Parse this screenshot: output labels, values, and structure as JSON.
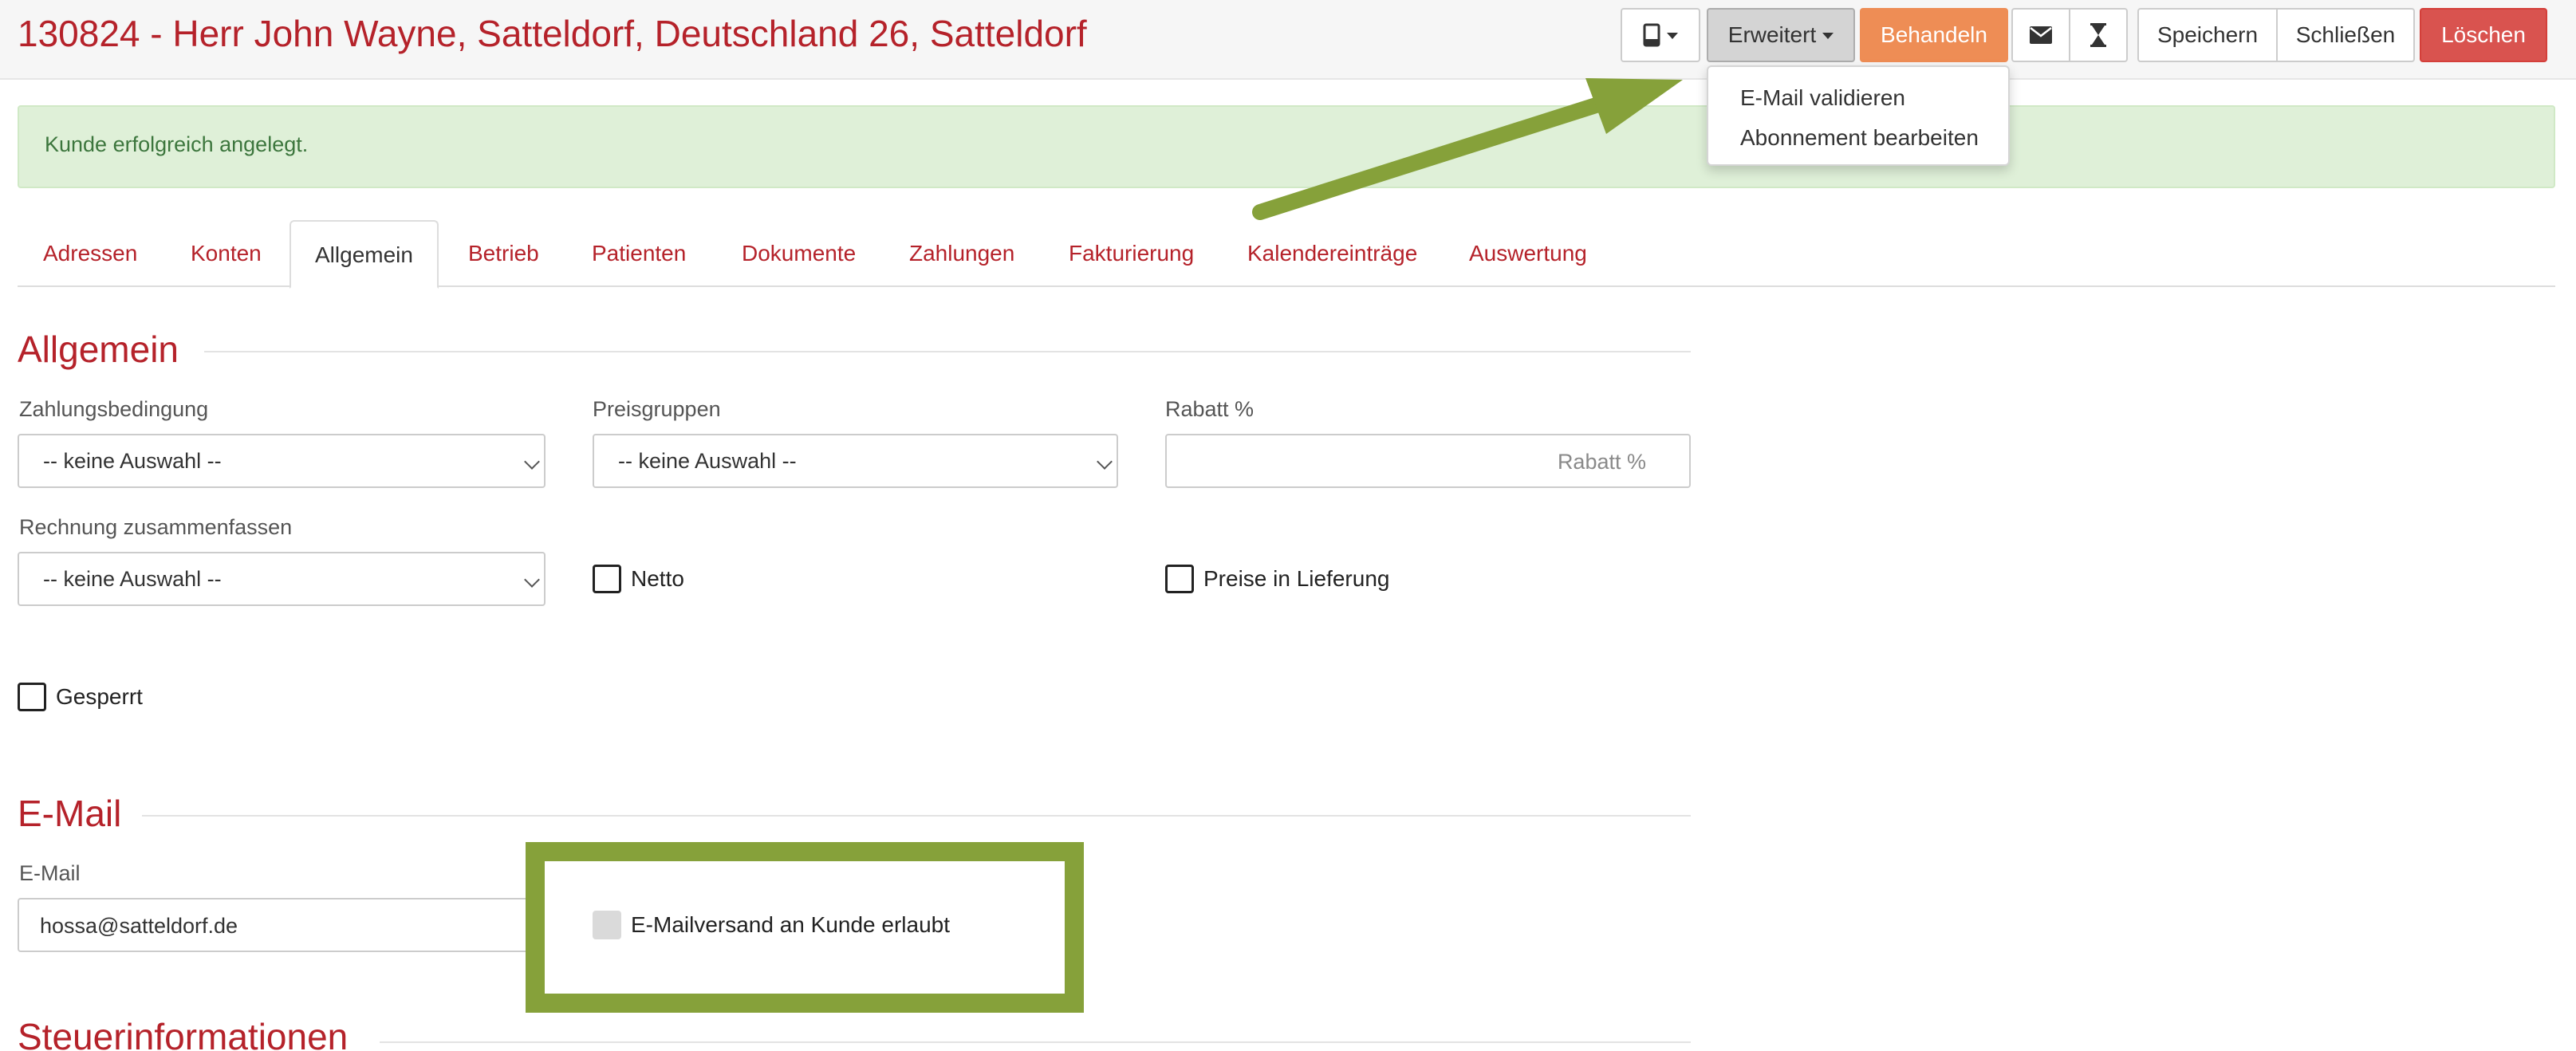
{
  "header": {
    "title": "130824 - Herr John Wayne, Satteldorf, Deutschland 26, Satteldorf",
    "buttons": {
      "erweitert": "Erweitert",
      "behandeln": "Behandeln",
      "speichern": "Speichern",
      "schliessen": "Schließen",
      "loeschen": "Löschen"
    },
    "icons": {
      "device": "tablet-icon",
      "mail": "envelope-icon",
      "hourglass": "hourglass-icon"
    }
  },
  "dropdown": {
    "items": [
      "E-Mail validieren",
      "Abonnement bearbeiten"
    ]
  },
  "alert": {
    "text": "Kunde erfolgreich angelegt."
  },
  "tabs": [
    "Adressen",
    "Konten",
    "Allgemein",
    "Betrieb",
    "Patienten",
    "Dokumente",
    "Zahlungen",
    "Fakturierung",
    "Kalendereinträge",
    "Auswertung"
  ],
  "active_tab": "Allgemein",
  "allgemein": {
    "title": "Allgemein",
    "zahlungsbedingung": {
      "label": "Zahlungsbedingung",
      "value": "-- keine Auswahl --"
    },
    "preisgruppen": {
      "label": "Preisgruppen",
      "value": "-- keine Auswahl --"
    },
    "rabatt": {
      "label": "Rabatt %",
      "placeholder": "Rabatt %"
    },
    "rechnung": {
      "label": "Rechnung zusammenfassen",
      "value": "-- keine Auswahl --"
    },
    "netto": {
      "label": "Netto",
      "checked": false
    },
    "preise_lieferung": {
      "label": "Preise in Lieferung",
      "checked": false
    },
    "gesperrt": {
      "label": "Gesperrt",
      "checked": false
    }
  },
  "email": {
    "title": "E-Mail",
    "field_label": "E-Mail",
    "value": "hossa@satteldorf.de",
    "versand": {
      "label": "E-Mailversand an Kunde erlaubt",
      "checked": false,
      "disabled": true
    }
  },
  "steuer": {
    "title": "Steuerinformationen"
  },
  "colors": {
    "brand_red": "#b5222a",
    "behandeln_orange": "#ee8d55",
    "delete_red": "#d9534f",
    "success_bg": "#dff0d8",
    "annotation_green": "#86a13a"
  }
}
